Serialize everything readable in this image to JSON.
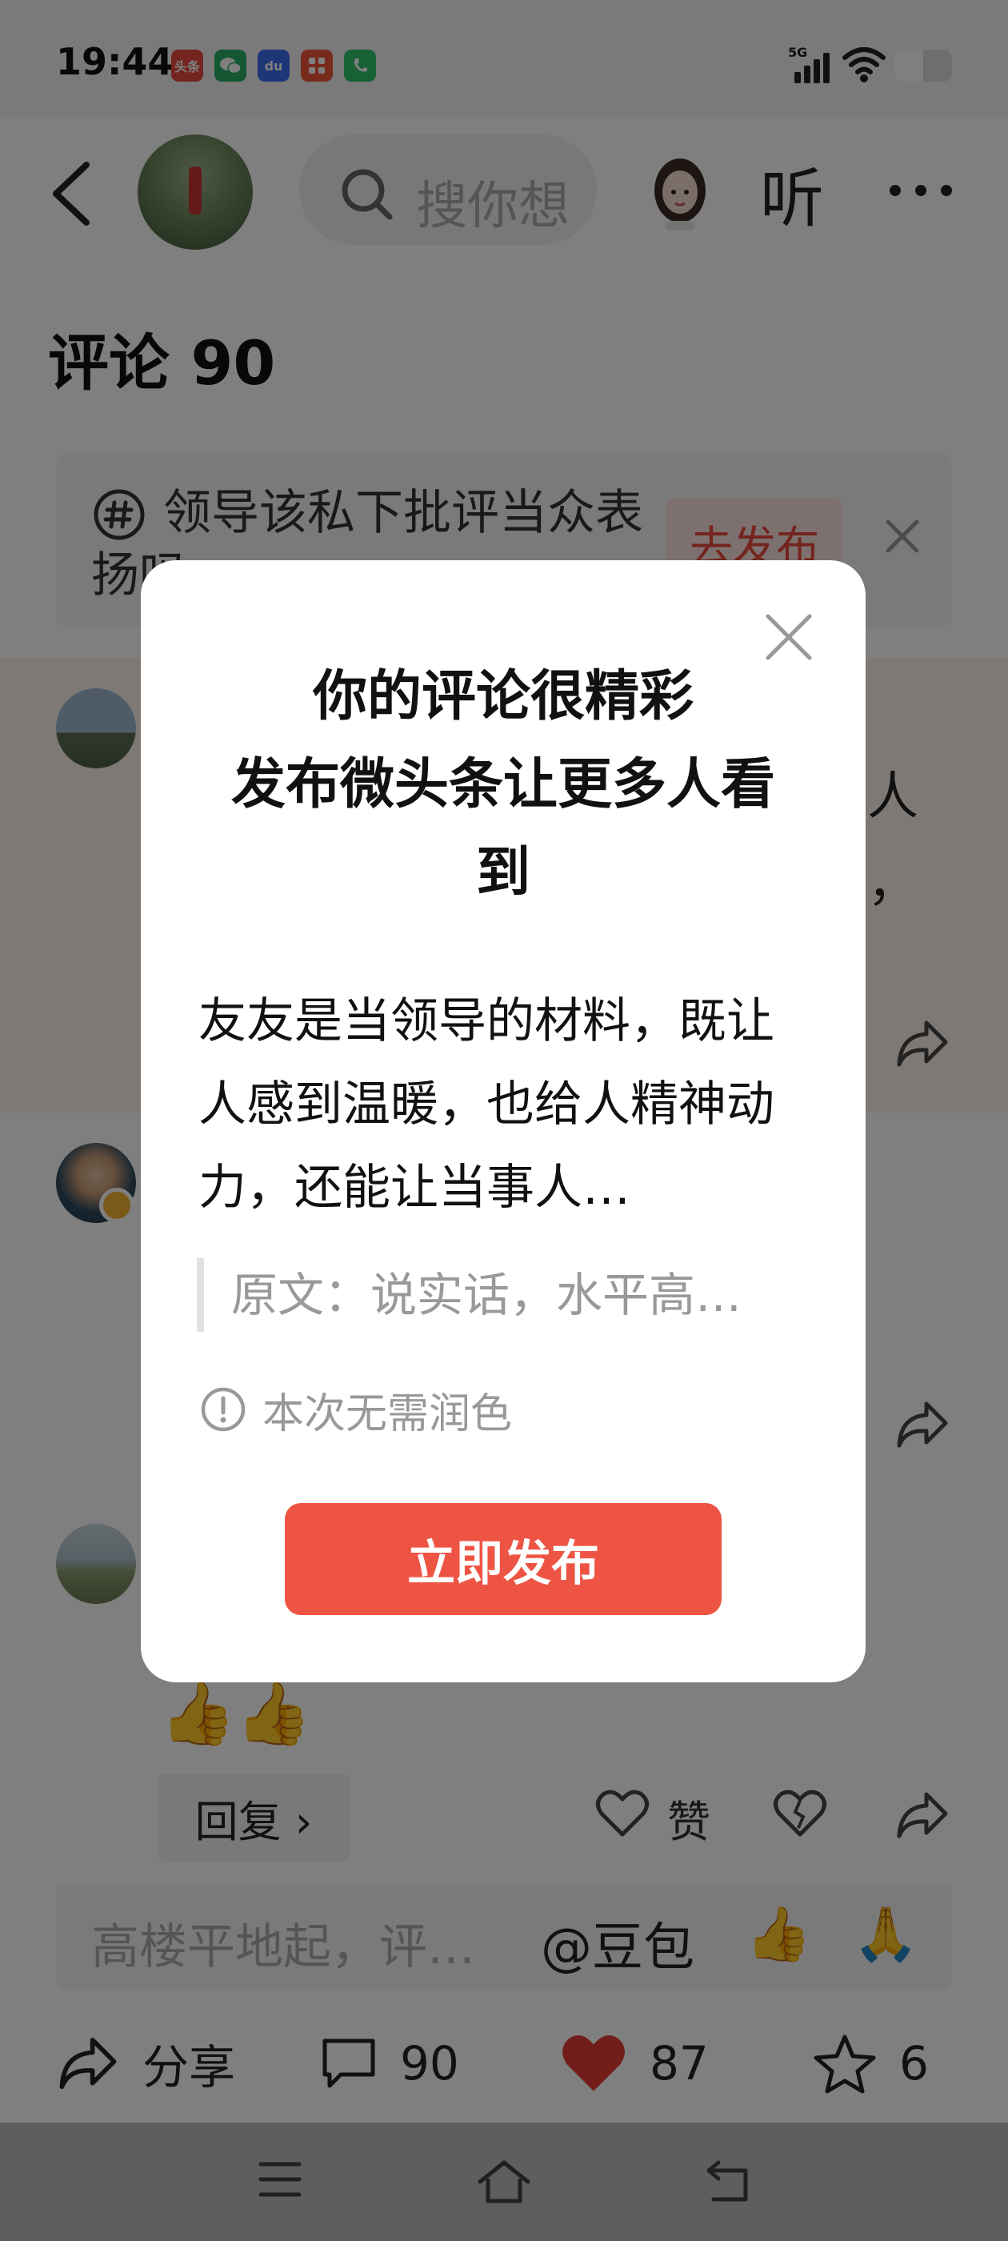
{
  "status_bar": {
    "time": "19:44",
    "apps": [
      {
        "label": "头条",
        "color": "#e8483c"
      },
      {
        "label": "",
        "color": "#2aae67"
      },
      {
        "label": "du",
        "color": "#3b6cf0"
      },
      {
        "label": "",
        "color": "#f0563a"
      },
      {
        "label": "",
        "color": "#2fc36b"
      }
    ],
    "network": "5G"
  },
  "nav": {
    "search_placeholder": "搜你想",
    "listen_label": "听"
  },
  "comments_title": "评论 90",
  "topic": {
    "text": "领导该私下批评当众表扬吗",
    "publish_label": "去发布"
  },
  "background_fragments": {
    "row1_a": "人",
    "row1_b": "，"
  },
  "thumbs": "👍👍",
  "reply_row": {
    "reply_label": "回复 ›",
    "like_label": "赞"
  },
  "comment_input": {
    "placeholder": "高楼平地起，评…",
    "mention": "@豆包",
    "emoji_1": "👍",
    "emoji_2": "🙏"
  },
  "actions": {
    "share_label": "分享",
    "comment_count": "90",
    "like_count": "87",
    "favorite_count": "6"
  },
  "dialog": {
    "title_line1": "你的评论很精彩",
    "title_line2": "发布微头条让更多人看到",
    "body": "友友是当领导的材料，既让人感到温暖，也给人精神动力，还能让当事人…",
    "quote": "原文：说实话，水平高…",
    "note": "本次无需润色",
    "publish_label": "立即发布"
  },
  "colors": {
    "accent": "#ee5444",
    "like_red": "#e33b34",
    "highlight_row": "#fff3ec"
  },
  "icons": [
    "back-icon",
    "search-icon",
    "hashtag-icon",
    "close-icon",
    "share-icon",
    "comment-icon",
    "heart-icon",
    "star-icon",
    "info-icon",
    "menu-icon",
    "home-icon",
    "return-icon",
    "broken-heart-icon"
  ]
}
